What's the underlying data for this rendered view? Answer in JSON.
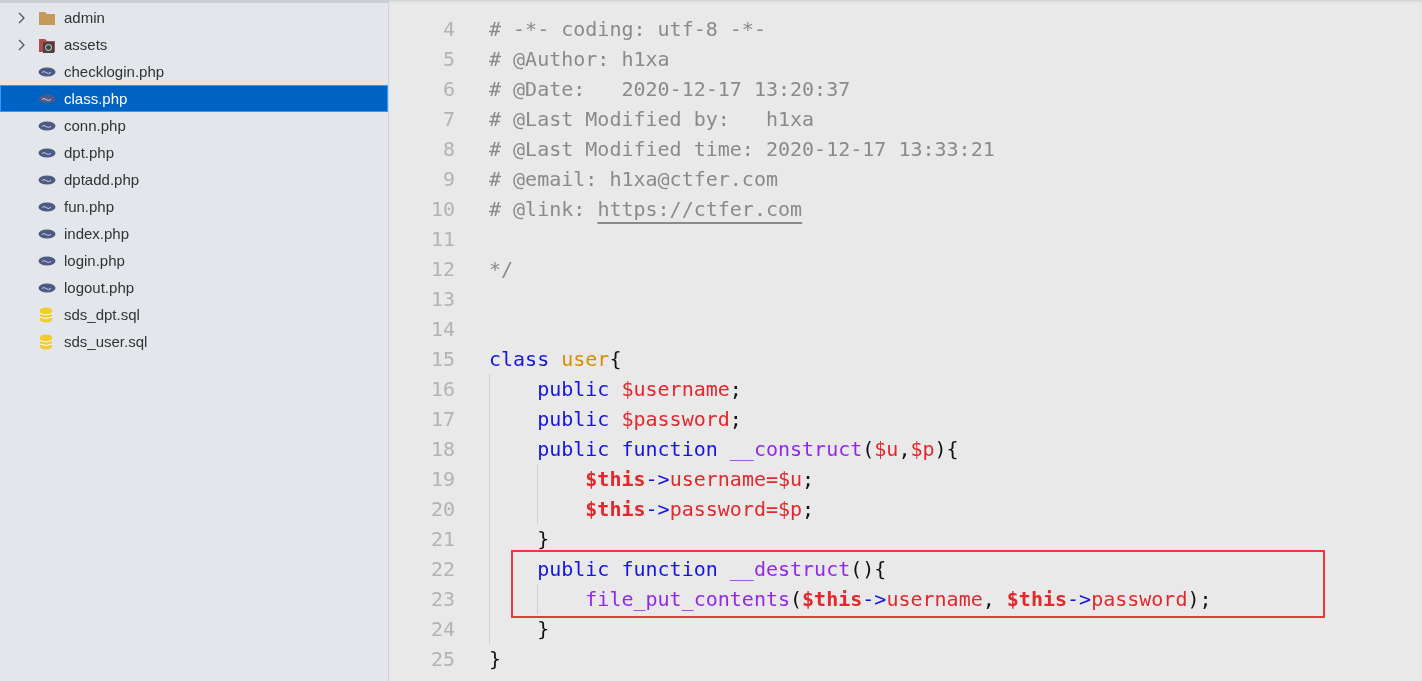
{
  "sidebar": {
    "items": [
      {
        "kind": "folder",
        "name": "admin",
        "expanded": false,
        "selected": false
      },
      {
        "kind": "folder-special",
        "name": "assets",
        "expanded": false,
        "selected": false
      },
      {
        "kind": "php",
        "name": "checklogin.php",
        "selected": false
      },
      {
        "kind": "php",
        "name": "class.php",
        "selected": true
      },
      {
        "kind": "php",
        "name": "conn.php",
        "selected": false
      },
      {
        "kind": "php",
        "name": "dpt.php",
        "selected": false
      },
      {
        "kind": "php",
        "name": "dptadd.php",
        "selected": false
      },
      {
        "kind": "php",
        "name": "fun.php",
        "selected": false
      },
      {
        "kind": "php",
        "name": "index.php",
        "selected": false
      },
      {
        "kind": "php",
        "name": "login.php",
        "selected": false
      },
      {
        "kind": "php",
        "name": "logout.php",
        "selected": false
      },
      {
        "kind": "sql",
        "name": "sds_dpt.sql",
        "selected": false
      },
      {
        "kind": "sql",
        "name": "sds_user.sql",
        "selected": false
      }
    ]
  },
  "editor": {
    "lines": [
      {
        "number": "4",
        "tokens": [
          {
            "kind": "comment",
            "text": "# -*- coding: utf-8 -*-"
          }
        ]
      },
      {
        "number": "5",
        "tokens": [
          {
            "kind": "comment",
            "text": "# @Author: h1xa"
          }
        ]
      },
      {
        "number": "6",
        "tokens": [
          {
            "kind": "comment",
            "text": "# @Date:   2020-12-17 13:20:37"
          }
        ]
      },
      {
        "number": "7",
        "tokens": [
          {
            "kind": "comment",
            "text": "# @Last Modified by:   h1xa"
          }
        ]
      },
      {
        "number": "8",
        "tokens": [
          {
            "kind": "comment",
            "text": "# @Last Modified time: 2020-12-17 13:33:21"
          }
        ]
      },
      {
        "number": "9",
        "tokens": [
          {
            "kind": "comment",
            "text": "# @email: h1xa@ctfer.com"
          }
        ]
      },
      {
        "number": "10",
        "tokens": [
          {
            "kind": "comment",
            "text": "# @link: "
          },
          {
            "kind": "link",
            "text": "https://ctfer.com"
          }
        ]
      },
      {
        "number": "11"
      },
      {
        "number": "12",
        "tokens": [
          {
            "kind": "comment",
            "text": "*/"
          }
        ]
      },
      {
        "number": "13"
      },
      {
        "number": "14"
      },
      {
        "number": "15",
        "tokens": [
          {
            "kind": "keyword",
            "text": "class "
          },
          {
            "kind": "class-name",
            "text": "user"
          },
          {
            "kind": "punct",
            "text": "{"
          }
        ]
      },
      {
        "number": "16",
        "tokens": [
          {
            "kind": "keyword",
            "text": "    public "
          },
          {
            "kind": "variable",
            "text": "$username"
          },
          {
            "kind": "punct",
            "text": ";"
          }
        ]
      },
      {
        "number": "17",
        "tokens": [
          {
            "kind": "keyword",
            "text": "    public "
          },
          {
            "kind": "variable",
            "text": "$password"
          },
          {
            "kind": "punct",
            "text": ";"
          }
        ]
      },
      {
        "number": "18",
        "tokens": [
          {
            "kind": "keyword",
            "text": "    public function "
          },
          {
            "kind": "function",
            "text": "__construct"
          },
          {
            "kind": "punct",
            "text": "("
          },
          {
            "kind": "variable",
            "text": "$u"
          },
          {
            "kind": "punct",
            "text": ","
          },
          {
            "kind": "variable",
            "text": "$p"
          },
          {
            "kind": "punct",
            "text": "){"
          }
        ]
      },
      {
        "number": "19",
        "tokens": [
          {
            "kind": "this",
            "text": "        $this"
          },
          {
            "kind": "arrow",
            "text": "->"
          },
          {
            "kind": "variable",
            "text": "username="
          },
          {
            "kind": "variable",
            "text": "$u"
          },
          {
            "kind": "punct",
            "text": ";"
          }
        ]
      },
      {
        "number": "20",
        "tokens": [
          {
            "kind": "this",
            "text": "        $this"
          },
          {
            "kind": "arrow",
            "text": "->"
          },
          {
            "kind": "variable",
            "text": "password="
          },
          {
            "kind": "variable",
            "text": "$p"
          },
          {
            "kind": "punct",
            "text": ";"
          }
        ]
      },
      {
        "number": "21",
        "tokens": [
          {
            "kind": "punct",
            "text": "    }"
          }
        ]
      },
      {
        "number": "22",
        "boxed": true,
        "tokens": [
          {
            "kind": "keyword",
            "text": "    public function "
          },
          {
            "kind": "function",
            "text": "__destruct"
          },
          {
            "kind": "punct",
            "text": "(){"
          }
        ]
      },
      {
        "number": "23",
        "boxed": true,
        "tokens": [
          {
            "kind": "function",
            "text": "        file_put_contents"
          },
          {
            "kind": "punct",
            "text": "("
          },
          {
            "kind": "this",
            "text": "$this"
          },
          {
            "kind": "arrow",
            "text": "->"
          },
          {
            "kind": "variable",
            "text": "username"
          },
          {
            "kind": "punct",
            "text": ", "
          },
          {
            "kind": "this",
            "text": "$this"
          },
          {
            "kind": "arrow",
            "text": "->"
          },
          {
            "kind": "variable",
            "text": "password"
          },
          {
            "kind": "punct",
            "text": ");"
          }
        ]
      },
      {
        "number": "24",
        "tokens": [
          {
            "kind": "punct",
            "text": "    }"
          }
        ]
      },
      {
        "number": "25",
        "tokens": [
          {
            "kind": "punct",
            "text": "}"
          }
        ]
      }
    ]
  }
}
